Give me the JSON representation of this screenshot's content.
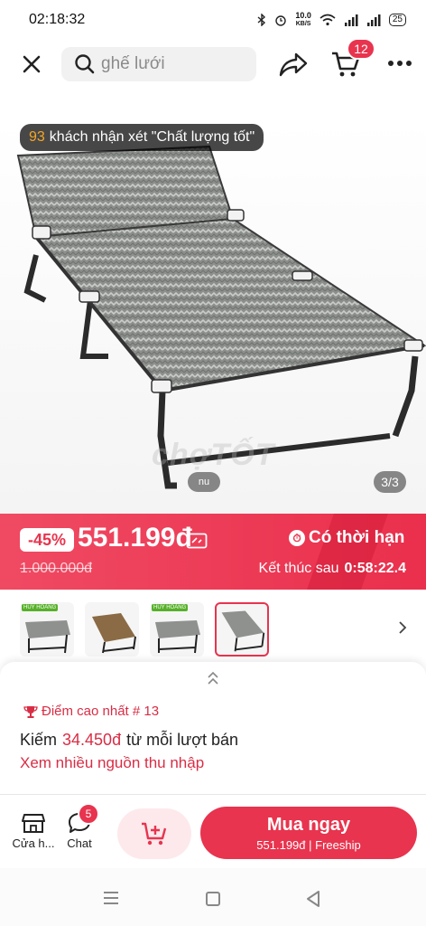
{
  "status": {
    "time": "02:18:32",
    "net_speed_value": "10.0",
    "net_speed_unit": "KB/S",
    "battery": "25"
  },
  "topbar": {
    "search_placeholder": "ghế lưới",
    "cart_count": "12"
  },
  "gallery": {
    "review_count": "93",
    "review_text": "khách nhận xét \"Chất lượng tốt\"",
    "watermark": "chợTỐT",
    "small_pill": "nu",
    "counter": "3/3"
  },
  "sale": {
    "discount": "-45%",
    "price": "551.199đ",
    "old_price": "1.000.000đ",
    "limited_label": "Có thời hạn",
    "countdown_label": "Kết thúc sau",
    "countdown_time": "0:58:22.4"
  },
  "thumbnails": [
    {
      "tag": "HUY HOÀNG",
      "selected": false
    },
    {
      "tag": "",
      "selected": false
    },
    {
      "tag": "HUY HOÀNG",
      "selected": false
    },
    {
      "tag": "",
      "selected": true
    }
  ],
  "earn": {
    "rank_label": "Điểm cao nhất # 13",
    "earn_prefix": "Kiếm",
    "earn_amount": "34.450đ",
    "earn_suffix": "từ mỗi lượt bán",
    "more_link": "Xem nhiều nguồn thu nhập"
  },
  "bottom": {
    "shop_label": "Cửa h...",
    "chat_label": "Chat",
    "chat_badge": "5",
    "buy_label": "Mua ngay",
    "buy_price": "551.199đ",
    "buy_shipping": "Freeship"
  },
  "colors": {
    "accent": "#e8344e",
    "earn_red": "#d92d45",
    "review_count": "#f5a623"
  },
  "icons": [
    "close-icon",
    "search-icon",
    "share-icon",
    "cart-icon",
    "more-icon",
    "voucher-icon",
    "stopwatch-icon",
    "chevron-right-icon",
    "chevron-up-icon",
    "trophy-icon",
    "shop-icon",
    "chat-icon",
    "add-cart-icon",
    "nav-menu-icon",
    "nav-home-icon",
    "nav-back-icon"
  ]
}
